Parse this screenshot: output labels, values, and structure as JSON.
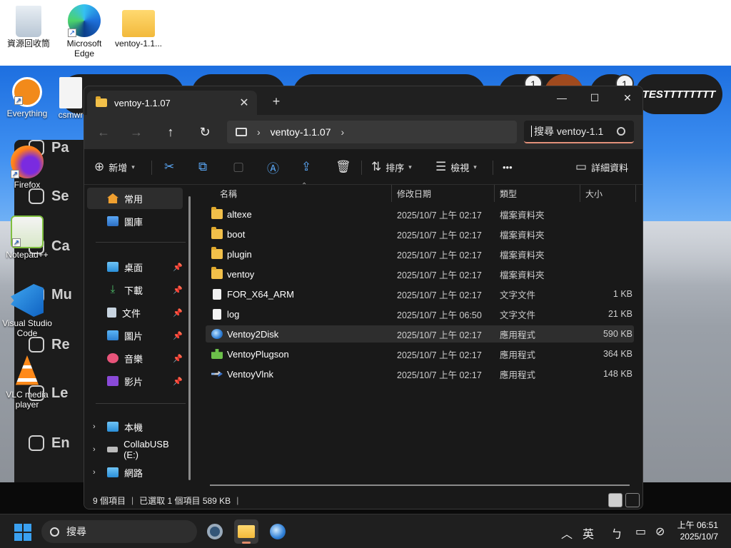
{
  "desktop": {
    "icons": [
      {
        "label": "資源回收筒"
      },
      {
        "label": "Microsoft Edge"
      },
      {
        "label": "ventoy-1.1..."
      },
      {
        "label": "Everything"
      },
      {
        "label": "Firefox"
      },
      {
        "label": "Notepad++"
      },
      {
        "label": "Visual Studio Code"
      },
      {
        "label": "VLC media player"
      },
      {
        "label": "csmwr"
      }
    ]
  },
  "background_app": {
    "rows": [
      "Pa",
      "Se",
      "Ca",
      "Mu",
      "Re",
      "Le",
      "En"
    ],
    "badge_1": "1",
    "badge_2": "1",
    "pill_text": "TESTTTTTTTT"
  },
  "explorer": {
    "tab_title": "ventoy-1.1.07",
    "tab_close": "✕",
    "new_tab": "+",
    "minimize": "—",
    "maximize": "☐",
    "close": "✕",
    "nav": {
      "back": "←",
      "forward": "→",
      "up": "↑",
      "refresh": "↻"
    },
    "address": {
      "chevron": "›",
      "segment": "ventoy-1.1.07"
    },
    "search": {
      "placeholder": "搜尋 ventoy-1.1"
    },
    "toolbar": {
      "new_label": "新增",
      "sort_label": "排序",
      "view_label": "檢視",
      "more_label": "•••",
      "details_label": "詳細資料"
    },
    "sidebar": {
      "home": "常用",
      "gallery": "圖庫",
      "desktop": "桌面",
      "downloads": "下載",
      "documents": "文件",
      "pictures": "圖片",
      "music": "音樂",
      "videos": "影片",
      "this_pc": "本機",
      "usb": "CollabUSB (E:)",
      "network": "網路"
    },
    "columns": {
      "name": "名稱",
      "date": "修改日期",
      "type": "類型",
      "size": "大小"
    },
    "files": [
      {
        "name": "altexe",
        "date": "2025/10/7 上午 02:17",
        "type": "檔案資料夾",
        "size": ""
      },
      {
        "name": "boot",
        "date": "2025/10/7 上午 02:17",
        "type": "檔案資料夾",
        "size": ""
      },
      {
        "name": "plugin",
        "date": "2025/10/7 上午 02:17",
        "type": "檔案資料夾",
        "size": ""
      },
      {
        "name": "ventoy",
        "date": "2025/10/7 上午 02:17",
        "type": "檔案資料夾",
        "size": ""
      },
      {
        "name": "FOR_X64_ARM",
        "date": "2025/10/7 上午 02:17",
        "type": "文字文件",
        "size": "1 KB"
      },
      {
        "name": "log",
        "date": "2025/10/7 上午 06:50",
        "type": "文字文件",
        "size": "21 KB"
      },
      {
        "name": "Ventoy2Disk",
        "date": "2025/10/7 上午 02:17",
        "type": "應用程式",
        "size": "590 KB"
      },
      {
        "name": "VentoyPlugson",
        "date": "2025/10/7 上午 02:17",
        "type": "應用程式",
        "size": "364 KB"
      },
      {
        "name": "VentoyVlnk",
        "date": "2025/10/7 上午 02:17",
        "type": "應用程式",
        "size": "148 KB"
      }
    ],
    "status": {
      "items": "9 個項目",
      "selected": "已選取 1 個項目 589 KB",
      "sep": "|"
    }
  },
  "taskbar": {
    "search_label": "搜尋",
    "ime": "英",
    "ime_mode": "ㄅ",
    "time": "上午 06:51",
    "date": "2025/10/7"
  },
  "colors": {
    "accent": "#e2917a",
    "folder": "#f2c04a",
    "window_bg": "#191919"
  }
}
